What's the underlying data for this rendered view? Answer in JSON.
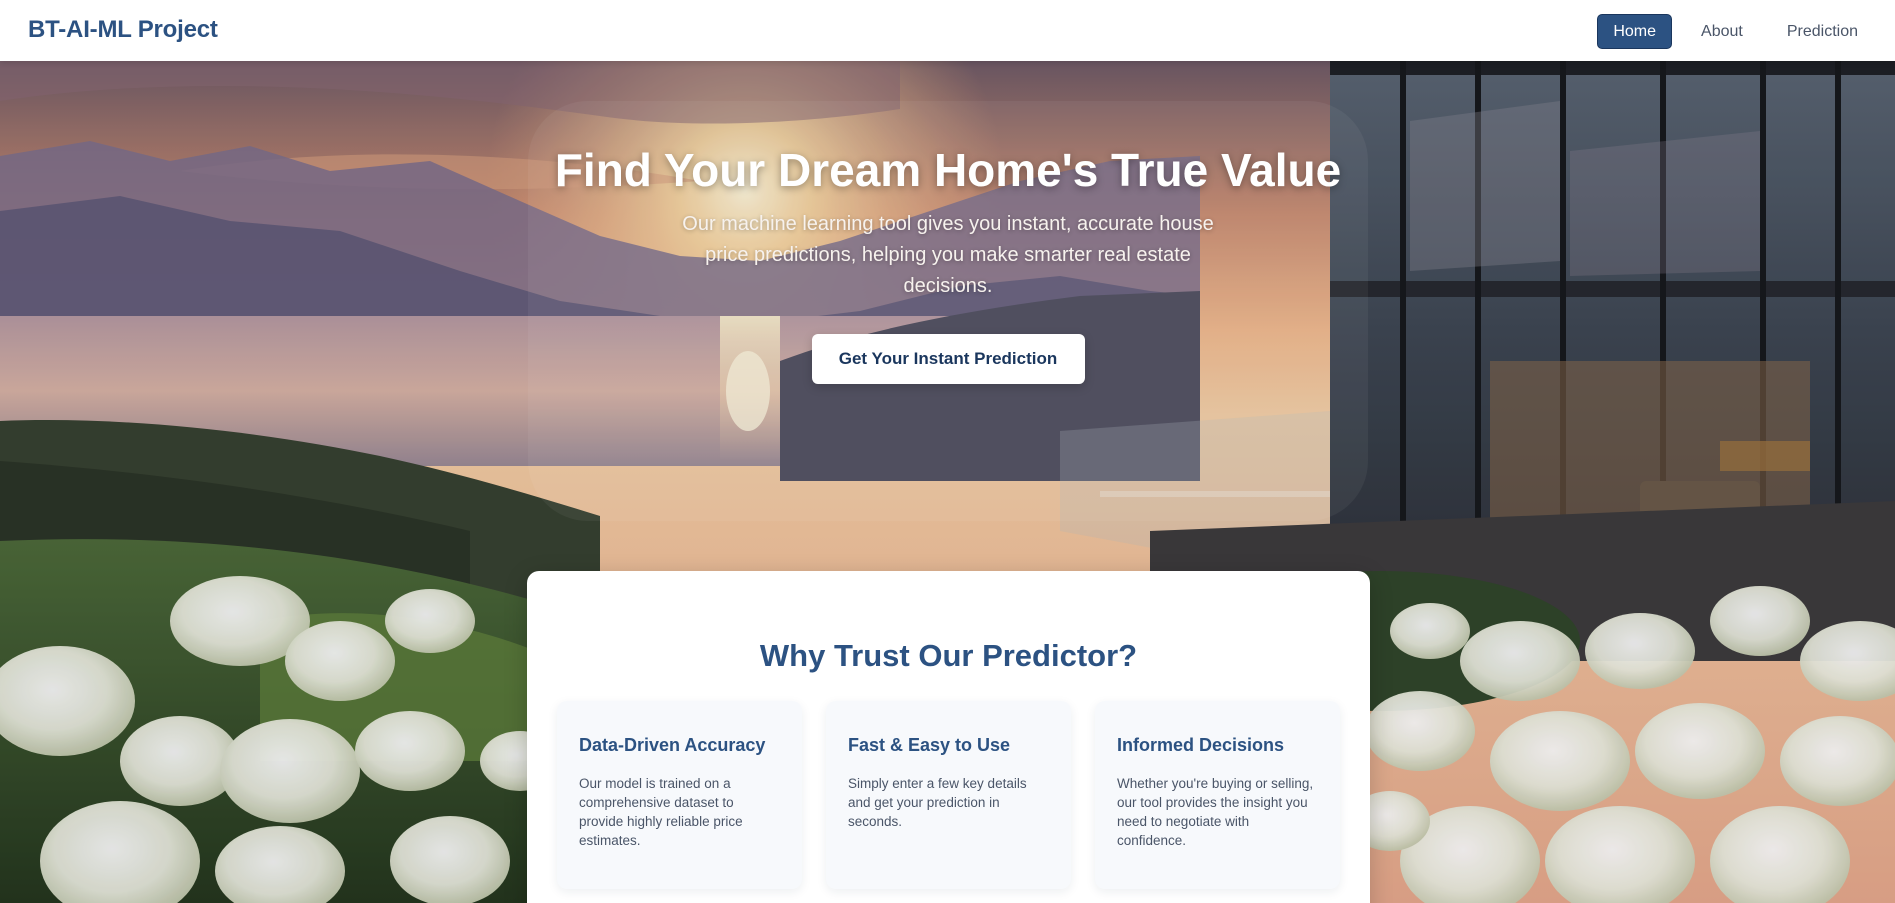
{
  "brand": {
    "name": "BT-AI-ML Project"
  },
  "nav": {
    "items": [
      {
        "label": "Home",
        "active": true
      },
      {
        "label": "About",
        "active": false
      },
      {
        "label": "Prediction",
        "active": false
      }
    ]
  },
  "hero": {
    "title": "Find Your Dream Home's True Value",
    "subtitle": "Our machine learning tool gives you instant, accurate house price predictions, helping you make smarter real estate decisions.",
    "cta_label": "Get Your Instant Prediction"
  },
  "features": {
    "title": "Why Trust Our Predictor?",
    "cards": [
      {
        "icon": "data-chart-icon",
        "heading": "Data-Driven Accuracy",
        "text": "Our model is trained on a comprehensive dataset to provide highly reliable price estimates."
      },
      {
        "icon": "lightning-icon",
        "heading": "Fast & Easy to Use",
        "text": "Simply enter a few key details and get your prediction in seconds."
      },
      {
        "icon": "decision-icon",
        "heading": "Informed Decisions",
        "text": "Whether you're buying or selling, our tool provides the insight you need to negotiate with confidence."
      }
    ]
  },
  "colors": {
    "brand": "#2c5282",
    "nav_active_bg": "#2c5282",
    "text_muted": "#4a5568"
  }
}
